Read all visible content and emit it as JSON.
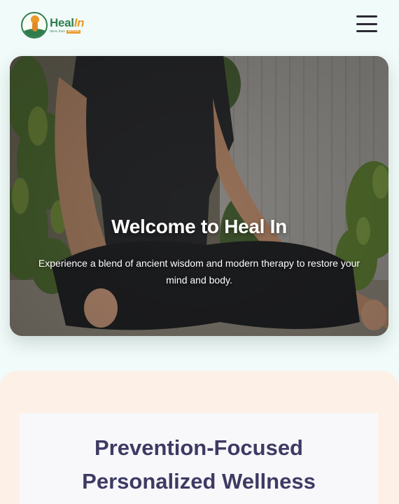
{
  "brand": {
    "name_part1": "Heal",
    "name_part2": "In",
    "tagline_part1": "HEAL from",
    "tagline_part2": "WITHIN"
  },
  "header": {
    "menu_icon": "hamburger-menu-icon"
  },
  "hero": {
    "title": "Welcome to Heal In",
    "subtitle": "Experience a blend of ancient wisdom and modern therapy to restore your mind and body."
  },
  "section": {
    "heading_line1": "Prevention-Focused",
    "heading_line2": "Personalized Wellness"
  },
  "colors": {
    "page_bg": "#f1fbf9",
    "brand_green": "#2f7d4f",
    "brand_orange": "#e99a2a",
    "section_bg": "#fdf1e7",
    "heading_text": "#3d3b63"
  }
}
